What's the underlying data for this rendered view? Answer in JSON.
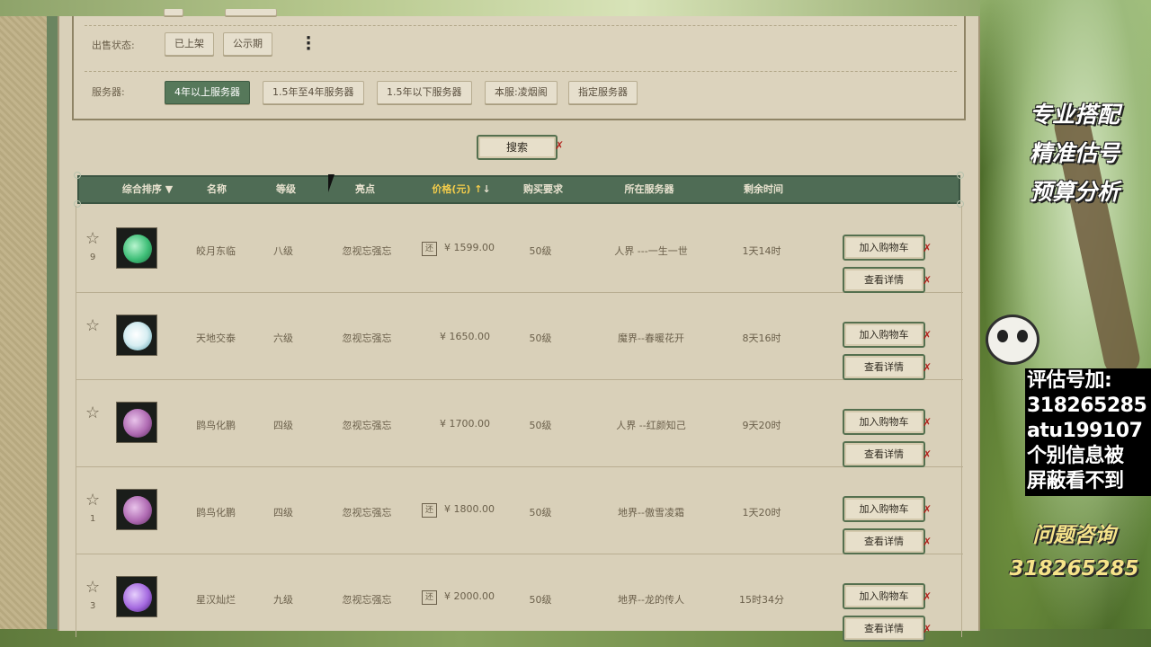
{
  "filters": {
    "sale_status_label": "出售状态:",
    "sale_status_options": [
      "已上架",
      "公示期"
    ],
    "more_label": "⋮",
    "server_label": "服务器:",
    "server_options": [
      "4年以上服务器",
      "1.5年至4年服务器",
      "1.5年以下服务器",
      "本服:凌烟阁",
      "指定服务器"
    ],
    "active_server": "4年以上服务器"
  },
  "search": {
    "label": "搜索"
  },
  "table": {
    "headers": {
      "sort": "综合排序",
      "name": "名称",
      "level": "等级",
      "highlight": "亮点",
      "price": "价格(元)",
      "requirement": "购买要求",
      "server": "所在服务器",
      "remaining": "剩余时间"
    },
    "rows": [
      {
        "fav": "9",
        "name": "皎月东临",
        "level": "八级",
        "highlight": "忽视忘强忘",
        "haggle": "还",
        "price": "¥ 1599.00",
        "requirement": "50级",
        "server": "人界 ---一生一世",
        "remaining": "1天14时",
        "orb_color": "#3fbf78"
      },
      {
        "fav": "",
        "name": "天地交泰",
        "level": "六级",
        "highlight": "忽视忘强忘",
        "haggle": "",
        "price": "¥ 1650.00",
        "requirement": "50级",
        "server": "魔界--春暖花开",
        "remaining": "8天16时",
        "orb_color": "#d7eef2"
      },
      {
        "fav": "",
        "name": "鹍鸟化鹏",
        "level": "四级",
        "highlight": "忽视忘强忘",
        "haggle": "",
        "price": "¥ 1700.00",
        "requirement": "50级",
        "server": "人界 --红颜知己",
        "remaining": "9天20时",
        "orb_color": "#b06bb3"
      },
      {
        "fav": "1",
        "name": "鹍鸟化鹏",
        "level": "四级",
        "highlight": "忽视忘强忘",
        "haggle": "还",
        "price": "¥ 1800.00",
        "requirement": "50级",
        "server": "地界--傲雪凌霜",
        "remaining": "1天20时",
        "orb_color": "#b06bb3"
      },
      {
        "fav": "3",
        "name": "星汉灿烂",
        "level": "九级",
        "highlight": "忽视忘强忘",
        "haggle": "还",
        "price": "¥ 2000.00",
        "requirement": "50级",
        "server": "地界--龙的传人",
        "remaining": "15时34分",
        "orb_color": "#a56ae0"
      }
    ],
    "add_cart_label": "加入购物车",
    "detail_label": "查看详情"
  },
  "promo": {
    "lines": [
      "专业搭配",
      "精准估号",
      "预算分析"
    ],
    "box_lines": [
      "评估号加:",
      "318265285",
      "atu199107",
      "个别信息被",
      "屏蔽看不到"
    ],
    "ask_lines": [
      "问题咨询",
      "318265285"
    ]
  },
  "colors": {
    "header_bg": "#4f6c55",
    "active_chip": "#56785a",
    "price_header": "#f3cc4b",
    "panel_bg": "#d9d0b9"
  }
}
